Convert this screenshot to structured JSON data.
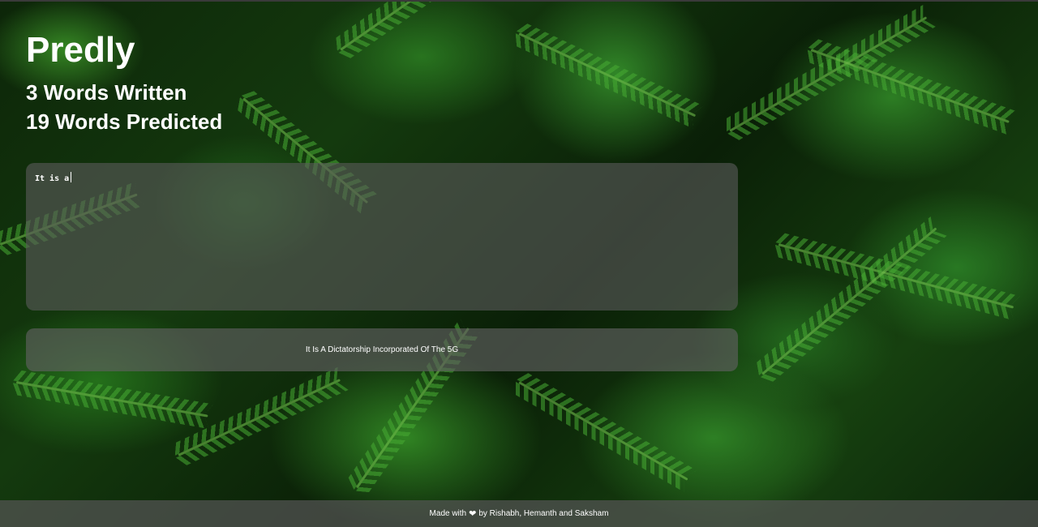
{
  "app": {
    "title": "Predly",
    "words_written_count": "3",
    "words_written_label": "Words Written",
    "words_predicted_count": "19",
    "words_predicted_label": "Words Predicted"
  },
  "editor": {
    "value": "It is a"
  },
  "prediction": {
    "text": "It Is A Dictatorship Incorporated Of The 5G"
  },
  "footer": {
    "made_with": "Made with",
    "heart_icon": "heart-icon",
    "by_text": "by Rishabh, Hemanth and Saksham"
  },
  "colors": {
    "text": "#ffffff",
    "panel": "#5a5a5a",
    "background": "#1a4a12"
  }
}
